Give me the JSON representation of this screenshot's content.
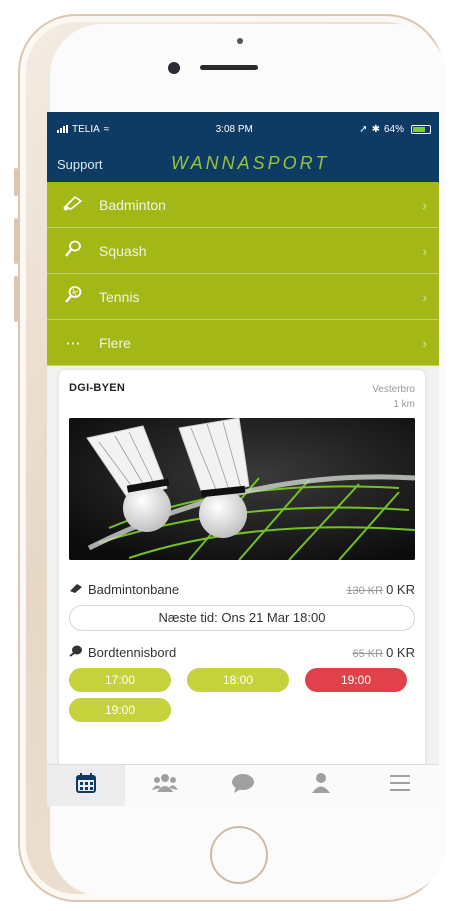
{
  "status": {
    "carrier": "TELIA",
    "time": "3:08 PM",
    "battery": "64%"
  },
  "nav": {
    "support": "Support",
    "brand": "WANNASPORT"
  },
  "menu": [
    {
      "label": "Badminton",
      "icon": "shuttlecock-icon"
    },
    {
      "label": "Squash",
      "icon": "squash-racket-icon"
    },
    {
      "label": "Tennis",
      "icon": "tennis-racket-icon"
    },
    {
      "label": "Flere",
      "icon": "more-dots-icon"
    }
  ],
  "venue": {
    "name": "DGI-BYEN",
    "area": "Vesterbro",
    "distance": "1 km"
  },
  "facilities": [
    {
      "name": "Badmintonbane",
      "old_price": "130 KR",
      "price": "0 KR",
      "next": "Næste tid: Ons 21 Mar 18:00"
    },
    {
      "name": "Bordtennisbord",
      "old_price": "65 KR",
      "price": "0 KR"
    }
  ],
  "times": [
    "17:00",
    "18:00",
    "19:00",
    "19:00"
  ],
  "colors": {
    "navy": "#0e3b63",
    "lime": "#a3b817",
    "chip": "#c6d23b",
    "red": "#e0414b"
  },
  "tabs": [
    "calendar-icon",
    "group-icon",
    "chat-icon",
    "profile-icon",
    "hamburger-menu-icon"
  ]
}
